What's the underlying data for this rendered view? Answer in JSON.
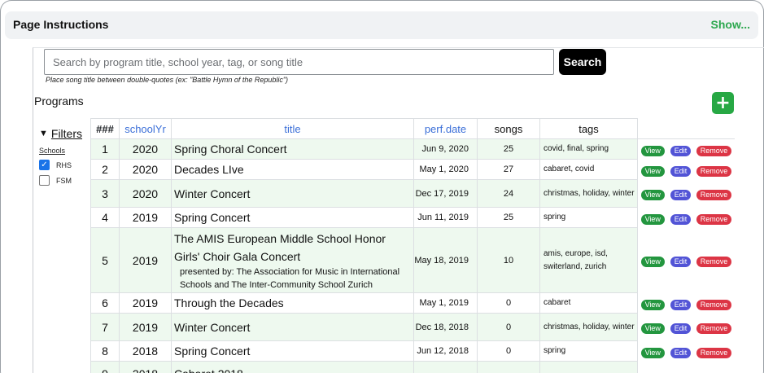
{
  "instructions": {
    "title": "Page Instructions",
    "show_label": "Show..."
  },
  "search": {
    "placeholder": "Search by program title, school year, tag, or song title",
    "value": "",
    "button_label": "Search",
    "hint": "Place song title between double-quotes (ex: \"Battle Hymn of the Republic\")"
  },
  "programs": {
    "label": "Programs",
    "add_label": "+"
  },
  "filters": {
    "label": "Filters",
    "schools_label": "Schools",
    "schools": [
      {
        "name": "RHS",
        "checked": true
      },
      {
        "name": "FSM",
        "checked": false
      }
    ]
  },
  "table": {
    "headers": {
      "num": "###",
      "schoolYr": "schoolYr",
      "title": "title",
      "perf_date": "perf.date",
      "songs": "songs",
      "tags": "tags"
    },
    "actions": {
      "view": "View",
      "edit": "Edit",
      "remove": "Remove"
    },
    "rows": [
      {
        "num": "1",
        "yr": "2020",
        "title": "Spring Choral Concert",
        "sub": "",
        "date": "Jun 9, 2020",
        "songs": "25",
        "tags": "covid, final, spring"
      },
      {
        "num": "2",
        "yr": "2020",
        "title": "Decades LIve",
        "sub": "",
        "date": "May 1, 2020",
        "songs": "27",
        "tags": "cabaret, covid"
      },
      {
        "num": "3",
        "yr": "2020",
        "title": "Winter Concert",
        "sub": "",
        "date": "Dec 17, 2019",
        "songs": "24",
        "tags": "christmas, holiday, winter"
      },
      {
        "num": "4",
        "yr": "2019",
        "title": "Spring Concert",
        "sub": "",
        "date": "Jun 11, 2019",
        "songs": "25",
        "tags": "spring"
      },
      {
        "num": "5",
        "yr": "2019",
        "title": "The AMIS European Middle School Honor Girls' Choir Gala Concert",
        "sub": "presented by: The Association for Music in International Schools and The Inter-Community School Zurich",
        "date": "May 18, 2019",
        "songs": "10",
        "tags": "amis, europe, isd, switerland, zurich"
      },
      {
        "num": "6",
        "yr": "2019",
        "title": "Through the Decades",
        "sub": "",
        "date": "May 1, 2019",
        "songs": "0",
        "tags": "cabaret"
      },
      {
        "num": "7",
        "yr": "2019",
        "title": "Winter Concert",
        "sub": "",
        "date": "Dec 18, 2018",
        "songs": "0",
        "tags": "christmas, holiday, winter"
      },
      {
        "num": "8",
        "yr": "2018",
        "title": "Spring Concert",
        "sub": "",
        "date": "Jun 12, 2018",
        "songs": "0",
        "tags": "spring"
      },
      {
        "num": "9",
        "yr": "2018",
        "title": "Cabaret 2018",
        "sub": "",
        "date": "",
        "songs": "",
        "tags": ""
      }
    ]
  },
  "colors": {
    "accent_green": "#27a844",
    "link_blue": "#3b6fd8",
    "row_alt": "#eef9ef",
    "view": "#23963f",
    "edit": "#5254d6",
    "remove": "#dc3545"
  }
}
